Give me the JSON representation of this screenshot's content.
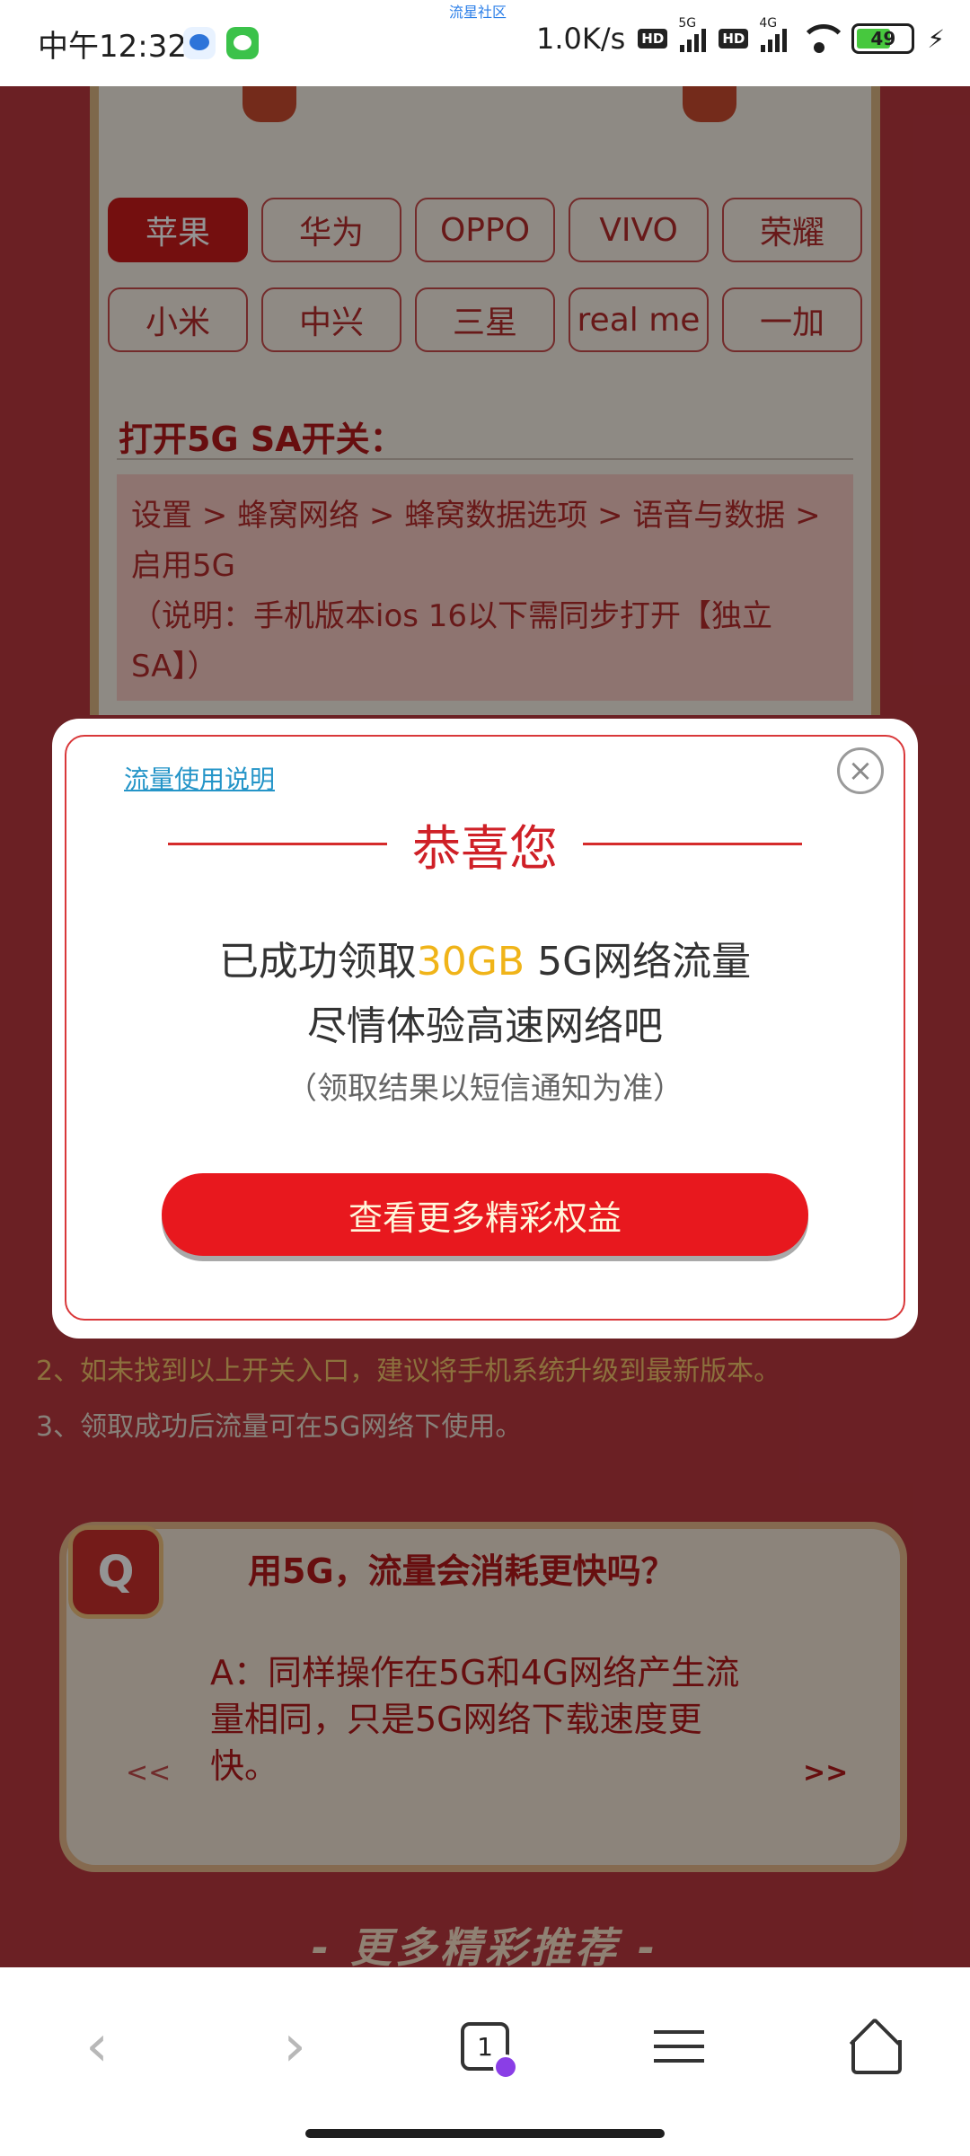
{
  "status_bar": {
    "time": "中午12:32",
    "top_center": "流星社区",
    "speed": "1.0K/s",
    "net1": "5G",
    "net2": "4G",
    "battery": "49"
  },
  "brands": [
    "苹果",
    "华为",
    "OPPO",
    "VIVO",
    "荣耀",
    "小米",
    "中兴",
    "三星",
    "real me",
    "一加"
  ],
  "sa_section": {
    "title": "打开5G SA开关：",
    "path": "设置 > 蜂窝网络 > 蜂窝数据选项 > 语音与数据 > 启用5G",
    "note": "（说明：手机版本ios 16以下需同步打开【独立SA】）"
  },
  "tips": {
    "tip2": "2、如未找到以上开关入口，建议将手机系统升级到最新版本。",
    "tip3": "3、领取成功后流量可在5G网络下使用。"
  },
  "qa": {
    "badge": "Q",
    "question": "用5G，流量会消耗更快吗？",
    "answer": "A：同样操作在5G和4G网络产生流量相同，只是5G网络下载速度更快。",
    "prev": "<<",
    "next": ">>"
  },
  "more_title": "- 更多精彩推荐 -",
  "modal": {
    "link": "流量使用说明",
    "close": "×",
    "title": "恭喜您",
    "line1_prefix": "已成功领取",
    "line1_amount": "30GB",
    "line1_suffix": " 5G网络流量",
    "line2": "尽情体验高速网络吧",
    "note": "（领取结果以短信通知为准）",
    "cta": "查看更多精彩权益"
  },
  "nav": {
    "back": "‹",
    "forward": "›",
    "tabs_count": "1"
  },
  "colors": {
    "accent_red": "#e8181e",
    "amount_gold": "#f0b419",
    "link_blue": "#2595c8"
  }
}
